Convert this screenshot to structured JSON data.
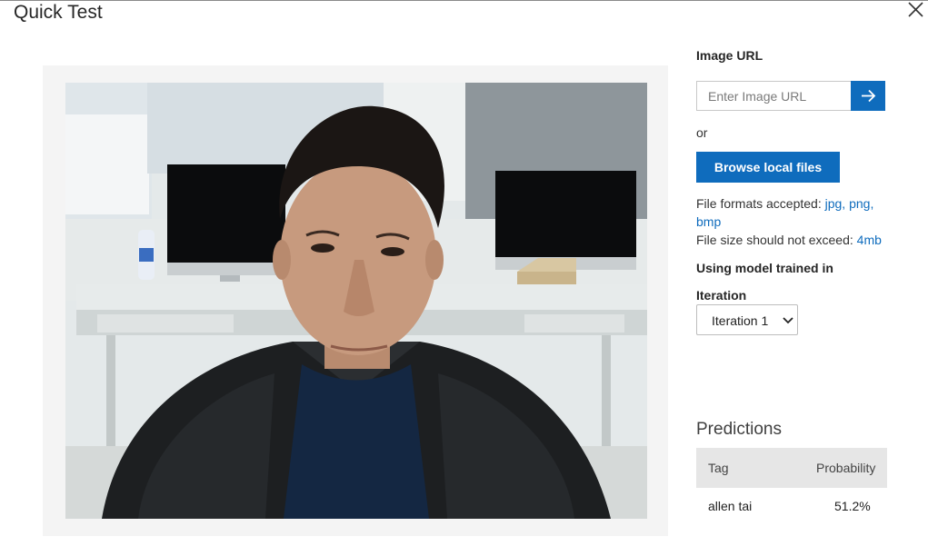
{
  "dialog": {
    "title": "Quick Test",
    "close_icon": "close-icon"
  },
  "preview": {
    "photo_icon": "person-photo"
  },
  "image_url": {
    "label": "Image URL",
    "placeholder": "Enter Image URL",
    "submit_icon": "arrow-right-icon"
  },
  "or_text": "or",
  "browse_label": "Browse local files",
  "file_info": {
    "formats_prefix": "File formats accepted: ",
    "format_jpg": "jpg,",
    "format_png": "png,",
    "format_bmp": "bmp",
    "size_prefix": "File size should not exceed: ",
    "size_value": "4mb"
  },
  "model_label": "Using model trained in",
  "iteration": {
    "label": "Iteration",
    "selected": "Iteration 1"
  },
  "predictions": {
    "heading": "Predictions",
    "columns": [
      "Tag",
      "Probability"
    ],
    "rows": [
      {
        "tag": "allen tai",
        "probability": "51.2%"
      }
    ]
  },
  "colors": {
    "accent": "#0f6cbd",
    "table_header": "#e6e6e6",
    "preview_bg": "#f4f4f4"
  }
}
